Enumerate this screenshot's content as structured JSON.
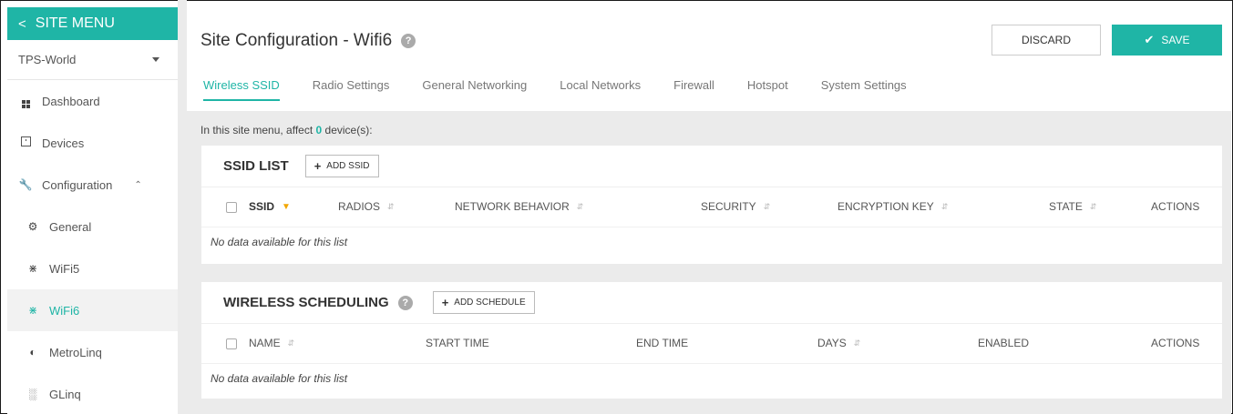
{
  "sidebar": {
    "header_label": "SITE MENU",
    "site_select_value": "TPS-World",
    "items": [
      {
        "label": "Dashboard"
      },
      {
        "label": "Devices"
      },
      {
        "label": "Configuration"
      },
      {
        "label": "General"
      },
      {
        "label": "WiFi5"
      },
      {
        "label": "WiFi6"
      },
      {
        "label": "MetroLinq"
      },
      {
        "label": "GLinq"
      }
    ]
  },
  "header": {
    "title": "Site Configuration - Wifi6",
    "discard_label": "DISCARD",
    "save_label": "SAVE"
  },
  "tabs": [
    {
      "label": "Wireless SSID",
      "active": true
    },
    {
      "label": "Radio Settings"
    },
    {
      "label": "General Networking"
    },
    {
      "label": "Local Networks"
    },
    {
      "label": "Firewall"
    },
    {
      "label": "Hotspot"
    },
    {
      "label": "System Settings"
    }
  ],
  "affect": {
    "prefix": "In this site menu, affect ",
    "count": "0",
    "suffix": " device(s):"
  },
  "ssid_list": {
    "title": "SSID LIST",
    "add_label": "ADD SSID",
    "columns": [
      "SSID",
      "RADIOS",
      "NETWORK BEHAVIOR",
      "SECURITY",
      "ENCRYPTION KEY",
      "STATE",
      "ACTIONS"
    ],
    "empty": "No data available for this list"
  },
  "scheduling": {
    "title": "WIRELESS SCHEDULING",
    "add_label": "ADD SCHEDULE",
    "columns": [
      "NAME",
      "START TIME",
      "END TIME",
      "DAYS",
      "ENABLED",
      "ACTIONS"
    ],
    "empty": "No data available for this list"
  },
  "colors": {
    "accent": "#1fb5a6",
    "sort_active": "#f2a600",
    "content_bg": "#ebebeb"
  }
}
